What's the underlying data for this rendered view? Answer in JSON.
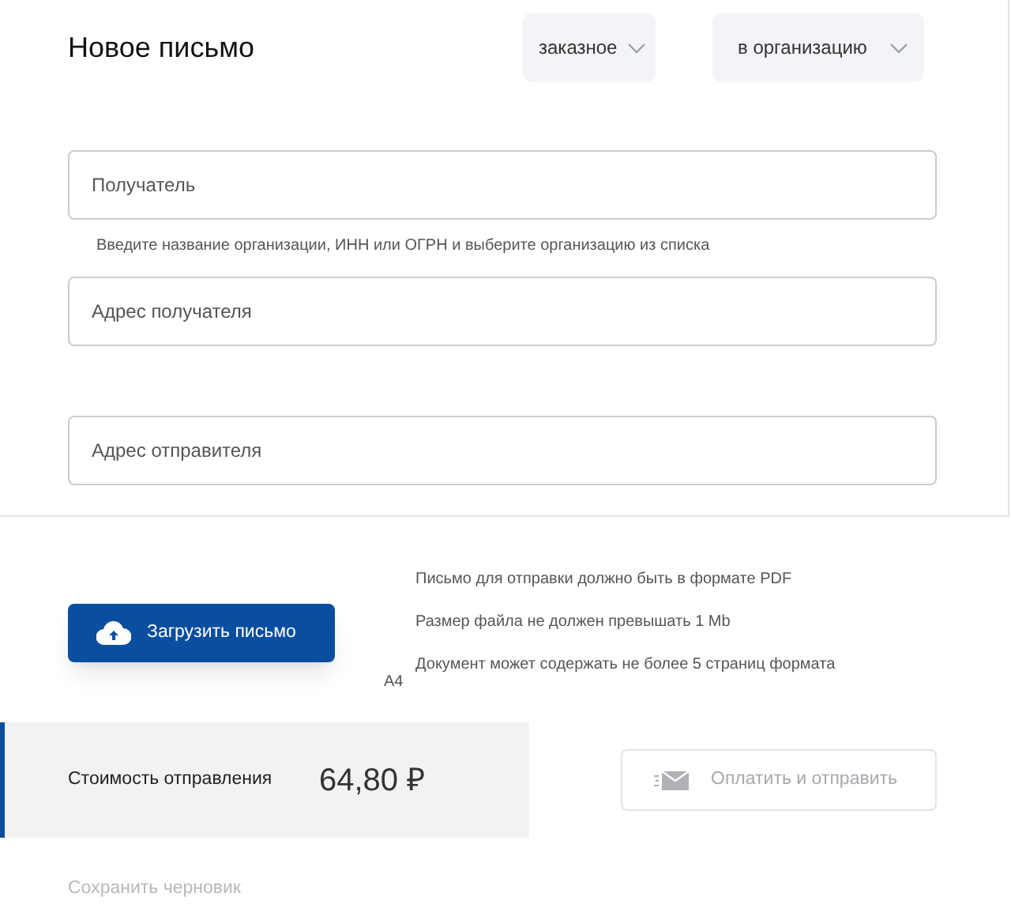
{
  "title": "Новое письмо",
  "dropdowns": [
    {
      "value": "заказное"
    },
    {
      "value": "в организацию"
    }
  ],
  "fields": [
    {
      "placeholder": "Получатель",
      "hint": "Введите название организации, ИНН или ОГРН и выберите организацию из списка"
    },
    {
      "placeholder": "Адрес получателя"
    },
    {
      "placeholder": "Адрес отправителя"
    }
  ],
  "upload_button": "Загрузить письмо",
  "rules": [
    {
      "text": "Письмо для отправки должно быть в формате PDF"
    },
    {
      "text": "Размер файла не должен превышать 1 Mb"
    },
    {
      "text": "Документ может содержать не более 5 страниц формата",
      "wrap": "A4"
    }
  ],
  "cost": {
    "label": "Стоимость отправления",
    "price": "64,80 ₽"
  },
  "pay_button": {
    "label": "Оплатить и отправить",
    "disabled": true
  },
  "save_draft": "Сохранить черновик"
}
